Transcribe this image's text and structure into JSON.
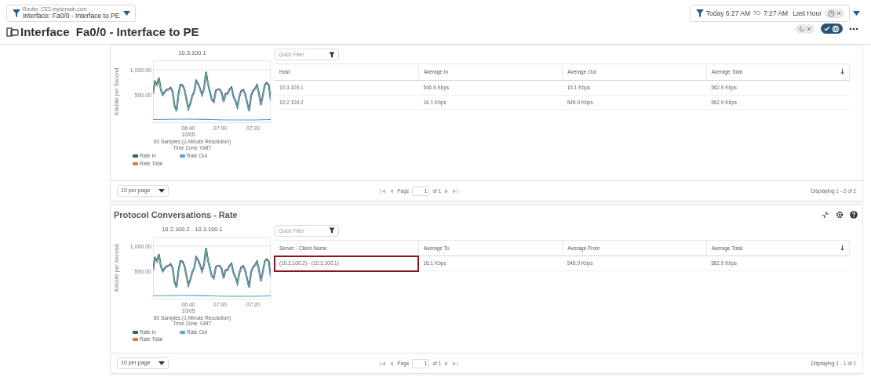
{
  "context_filter": {
    "lines": [
      "Router: CE2.mydomain.com",
      "Interface: Fa0/0 - Interface to PE"
    ]
  },
  "page_title": "Interface  Fa0/0 - Interface to PE",
  "time_range": {
    "from": "Today 6:27 AM",
    "to_word": "TO",
    "to": "7:27 AM",
    "preset": "Last Hour"
  },
  "view_toggle": {
    "on": true
  },
  "panels": [
    {
      "chart": {
        "title": "10.3.100.1",
        "y_axis_label": "Kilobits per Second",
        "y_ticks": [
          "1,000.00",
          "500.00"
        ],
        "x_ticks": [
          {
            "label": "06:40",
            "sublabel": "10/05"
          },
          {
            "label": "07:00"
          },
          {
            "label": "07:20"
          }
        ],
        "caption": [
          "60 Samples (1-Minute Resolution)",
          "Time Zone: GMT"
        ],
        "legend": [
          {
            "label": "Rate In",
            "color": "#2f5f7a"
          },
          {
            "label": "Rate Out",
            "color": "#5aaac6"
          },
          {
            "label": "Rate Total",
            "color": "#c8892c"
          }
        ]
      },
      "filter_placeholder": "Quick Filter",
      "table": {
        "columns": [
          {
            "label": "Host",
            "sorted": false
          },
          {
            "label": "Average In",
            "sorted": false
          },
          {
            "label": "Average Out",
            "sorted": false
          },
          {
            "label": "Average Total",
            "sorted": true
          }
        ],
        "rows": [
          {
            "cells": [
              "10.3.100.1",
              "546.9 Kbps",
              "16.1 Kbps",
              "562.9 Kbps"
            ],
            "highlighted": false
          },
          {
            "cells": [
              "10.2.100.2",
              "16.1 Kbps",
              "546.9 Kbps",
              "562.9 Kbps"
            ],
            "highlighted": false
          }
        ]
      },
      "footer": {
        "per_page": "10 per page",
        "page_label": "Page",
        "page_value": "1",
        "of_label": "of 1",
        "displaying": "Displaying 1 - 2 of 2"
      }
    },
    {
      "title": "Protocol Conversations - Rate",
      "chart": {
        "title": "10.2.100.2 - 10.3.100.1",
        "y_axis_label": "Kilobits per Second",
        "y_ticks": [
          "1,000.00",
          "500.00"
        ],
        "x_ticks": [
          {
            "label": "06:40",
            "sublabel": "10/05"
          },
          {
            "label": "07:00"
          },
          {
            "label": "07:20"
          }
        ],
        "caption": [
          "60 Samples (1-Minute Resolution)",
          "Time Zone: GMT"
        ],
        "legend": [
          {
            "label": "Rate In",
            "color": "#2f5f7a"
          },
          {
            "label": "Rate Out",
            "color": "#5aaac6"
          },
          {
            "label": "Rate Total",
            "color": "#c8892c"
          }
        ]
      },
      "filter_placeholder": "Quick Filter",
      "table": {
        "columns": [
          {
            "label": "Server - Client Name",
            "sorted": false
          },
          {
            "label": "Average To",
            "sorted": false
          },
          {
            "label": "Average From",
            "sorted": false
          },
          {
            "label": "Average Total",
            "sorted": true
          }
        ],
        "rows": [
          {
            "cells": [
              "(10.2.100.2) - (10.3.100.1)",
              "16.1 Kbps",
              "546.9 Kbps",
              "562.9 Kbps"
            ],
            "highlighted": true
          }
        ]
      },
      "footer": {
        "per_page": "10 per page",
        "page_label": "Page",
        "page_value": "1",
        "of_label": "of 1",
        "displaying": "Displaying 1 - 1 of 1"
      }
    }
  ]
}
